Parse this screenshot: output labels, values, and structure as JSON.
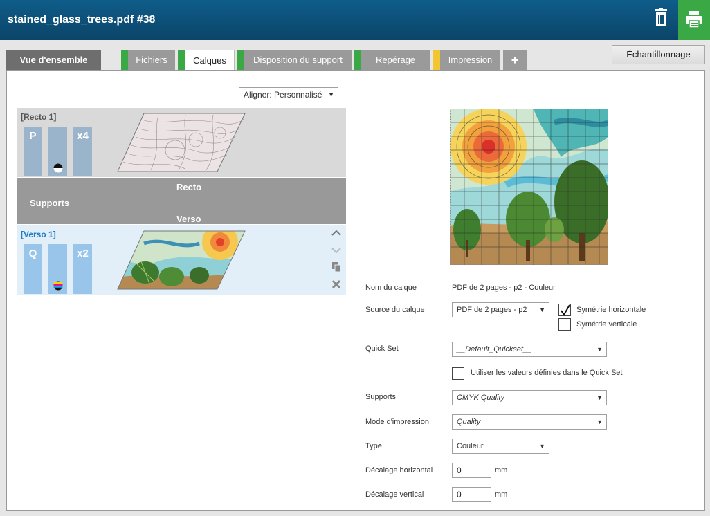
{
  "window": {
    "title": "stained_glass_trees.pdf #38"
  },
  "tabs": [
    {
      "label": "Vue d'ensemble",
      "color": "#6e6e6e"
    },
    {
      "label": "Fichiers",
      "color": "#3aa845"
    },
    {
      "label": "Calques",
      "color": "#3aa845"
    },
    {
      "label": "Disposition du support",
      "color": "#3aa845"
    },
    {
      "label": "Repérage",
      "color": "#3aa845"
    },
    {
      "label": "Impression",
      "color": "#f2c531"
    },
    {
      "label": "+"
    }
  ],
  "sample_button": "Échantillonnage",
  "align_select": {
    "value": "Aligner: Personnalisé"
  },
  "layers": {
    "recto": {
      "label": "[Recto 1]",
      "col1": "P",
      "col3": "x4"
    },
    "separator": {
      "recto": "Recto",
      "supports": "Supports",
      "verso": "Verso"
    },
    "verso": {
      "label": "[Verso 1]",
      "col1": "Q",
      "col3": "x2"
    }
  },
  "form": {
    "layer_name_label": "Nom du calque",
    "layer_name_value": "PDF de 2 pages - p2 - Couleur",
    "source_label": "Source du calque",
    "source_value": "PDF de 2 pages - p2",
    "mirror_h_label": "Symétrie horizontale",
    "mirror_h_checked": true,
    "mirror_v_label": "Symétrie verticale",
    "mirror_v_checked": false,
    "quickset_label": "Quick Set",
    "quickset_value": "__Default_Quickset__",
    "use_quickset_label": "Utiliser les valeurs définies dans le Quick Set",
    "supports_label": "Supports",
    "supports_value": "CMYK Quality",
    "mode_label": "Mode d'impression",
    "mode_value": "Quality",
    "type_label": "Type",
    "type_value": "Couleur",
    "offset_h_label": "Décalage horizontal",
    "offset_h_value": "0",
    "offset_v_label": "Décalage vertical",
    "offset_v_value": "0",
    "unit": "mm"
  }
}
